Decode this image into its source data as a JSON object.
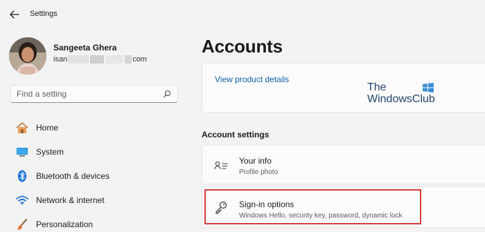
{
  "window": {
    "app_title": "Settings"
  },
  "user": {
    "name": "Sangeeta Ghera",
    "email_prefix": "isan",
    "email_suffix": "com"
  },
  "search": {
    "placeholder": "Find a setting"
  },
  "sidebar": {
    "items": [
      {
        "label": "Home",
        "icon": "home-icon"
      },
      {
        "label": "System",
        "icon": "system-icon"
      },
      {
        "label": "Bluetooth & devices",
        "icon": "bluetooth-icon"
      },
      {
        "label": "Network & internet",
        "icon": "wifi-icon"
      },
      {
        "label": "Personalization",
        "icon": "brush-icon"
      }
    ]
  },
  "main": {
    "page_title": "Accounts",
    "product_link": "View product details",
    "watermark": {
      "line1": "The",
      "line2": "WindowsClub"
    },
    "section_heading": "Account settings",
    "rows": [
      {
        "title": "Your info",
        "subtitle": "Profile photo",
        "icon": "person-card-icon"
      },
      {
        "title": "Sign-in options",
        "subtitle": "Windows Hello, security key, password, dynamic lock",
        "icon": "key-icon"
      }
    ]
  },
  "colors": {
    "accent_link": "#0f5fa8",
    "highlight": "#d23c3c",
    "background": "#f3f3f3"
  }
}
